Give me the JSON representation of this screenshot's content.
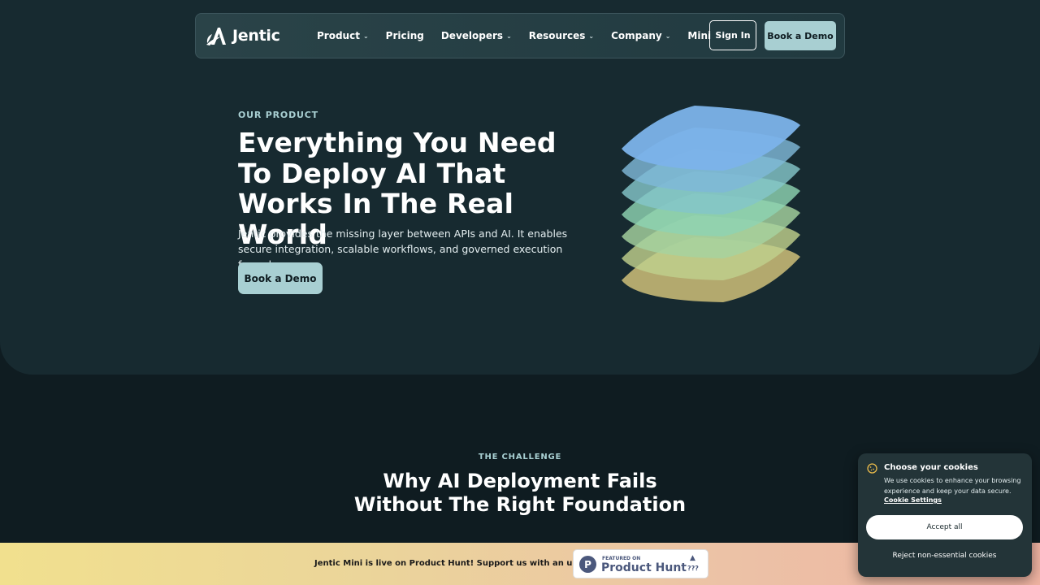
{
  "nav": {
    "logo_text": "Jentic",
    "items": [
      {
        "label": "Product",
        "dropdown": true
      },
      {
        "label": "Pricing",
        "dropdown": false
      },
      {
        "label": "Developers",
        "dropdown": true
      },
      {
        "label": "Resources",
        "dropdown": true
      },
      {
        "label": "Company",
        "dropdown": true
      },
      {
        "label": "Mini",
        "dropdown": false
      }
    ],
    "sign_in": "Sign In",
    "book_demo": "Book a Demo"
  },
  "hero": {
    "eyebrow": "OUR PRODUCT",
    "title": "Everything You Need To Deploy AI That Works In The Real World",
    "description": "Jentic provides the missing layer between APIs and AI. It enables secure integration, scalable workflows, and governed execution from day one.",
    "cta": "Book a Demo",
    "illustration": "stacked-layers-illustration"
  },
  "challenge": {
    "eyebrow": "THE CHALLENGE",
    "title_line1": "Why AI Deployment Fails",
    "title_line2": "Without The Right Foundation"
  },
  "banner": {
    "text": "Jentic Mini is live on Product Hunt! Support us with an upvote",
    "badge_small": "FEATURED ON",
    "badge_name": "Product Hunt",
    "badge_count": "???"
  },
  "cookie": {
    "title": "Choose your cookies",
    "text": "We use cookies to enhance your browsing experience and keep your data secure.",
    "settings_link": "Cookie Settings",
    "accept": "Accept all",
    "reject": "Reject non-essential cookies"
  },
  "colors": {
    "background": "#0f1c21",
    "hero_background": "#172a30",
    "accent": "#a8cfd2"
  }
}
